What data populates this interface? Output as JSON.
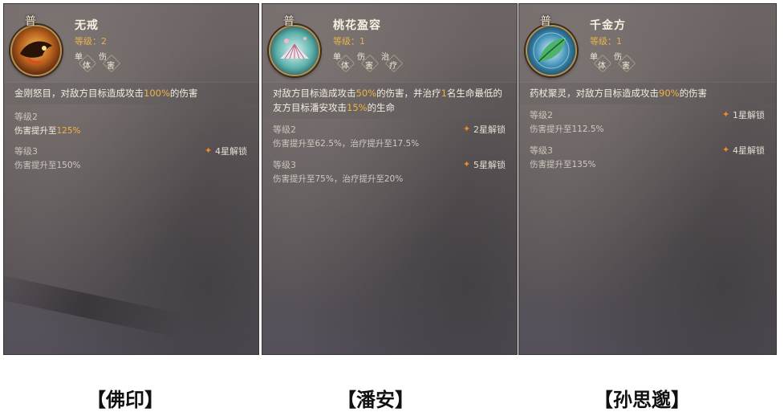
{
  "panels": [
    {
      "badge": "普",
      "skill_name": "无戒",
      "level_label": "等级：2",
      "tags": [
        {
          "a": "单",
          "b": "体"
        },
        {
          "a": "伤",
          "b": "害"
        }
      ],
      "emblem_theme": "fire",
      "description_parts": [
        {
          "text": "金刚怒目，对敌方目标造成攻击",
          "hl": false
        },
        {
          "text": "100%",
          "hl": true
        },
        {
          "text": "的伤害",
          "hl": false
        }
      ],
      "levels": [
        {
          "label": "等级2",
          "effect_parts": [
            {
              "text": "伤害提升至",
              "hl": false
            },
            {
              "text": "125%",
              "hl": true
            }
          ],
          "active": true,
          "unlock": ""
        },
        {
          "label": "等级3",
          "effect_parts": [
            {
              "text": "伤害提升至150%",
              "hl": false
            }
          ],
          "active": false,
          "unlock": "4星解锁"
        }
      ],
      "caption": "【佛印】"
    },
    {
      "badge": "普",
      "skill_name": "桃花盈容",
      "level_label": "等级：1",
      "tags": [
        {
          "a": "单",
          "b": "体"
        },
        {
          "a": "伤",
          "b": "害"
        },
        {
          "a": "治",
          "b": "疗"
        }
      ],
      "emblem_theme": "fan",
      "description_parts": [
        {
          "text": "对敌方目标造成攻击",
          "hl": false
        },
        {
          "text": "50%",
          "hl": true
        },
        {
          "text": "的伤害，并治疗",
          "hl": false
        },
        {
          "text": "1",
          "hl": true
        },
        {
          "text": "名生命最低的友方目标潘安攻击",
          "hl": false
        },
        {
          "text": "15%",
          "hl": true
        },
        {
          "text": "的生命",
          "hl": false
        }
      ],
      "levels": [
        {
          "label": "等级2",
          "effect_parts": [
            {
              "text": "伤害提升至62.5%，治疗提升至17.5%",
              "hl": false
            }
          ],
          "active": false,
          "unlock": "2星解锁"
        },
        {
          "label": "等级3",
          "effect_parts": [
            {
              "text": "伤害提升至75%，治疗提升至20%",
              "hl": false
            }
          ],
          "active": false,
          "unlock": "5星解锁"
        }
      ],
      "caption": "【潘安】"
    },
    {
      "badge": "普",
      "skill_name": "千金方",
      "level_label": "等级：1",
      "tags": [
        {
          "a": "单",
          "b": "体"
        },
        {
          "a": "伤",
          "b": "害"
        }
      ],
      "emblem_theme": "leaf",
      "description_parts": [
        {
          "text": "药杖聚灵，对敌方目标造成攻击",
          "hl": false
        },
        {
          "text": "90%",
          "hl": true
        },
        {
          "text": "的伤害",
          "hl": false
        }
      ],
      "levels": [
        {
          "label": "等级2",
          "effect_parts": [
            {
              "text": "伤害提升至112.5%",
              "hl": false
            }
          ],
          "active": false,
          "unlock": "1星解锁"
        },
        {
          "label": "等级3",
          "effect_parts": [
            {
              "text": "伤害提升至135%",
              "hl": false
            }
          ],
          "active": false,
          "unlock": "4星解锁"
        }
      ],
      "caption": "【孙思邈】"
    }
  ],
  "colors": {
    "highlight": "#f0b343",
    "level_text": "#e8b24c",
    "star": "#f08a2a",
    "panel_bg": "#625b5c"
  }
}
